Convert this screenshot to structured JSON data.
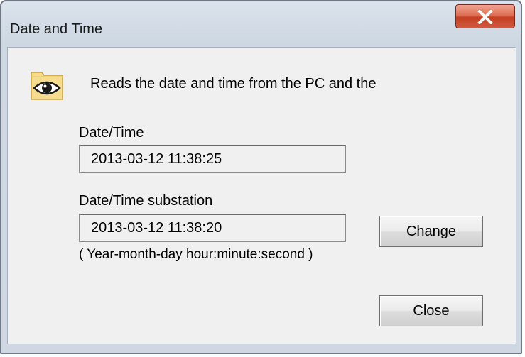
{
  "window": {
    "title": "Date and Time"
  },
  "icons": {
    "titlebar_close": "close-icon",
    "header": "eye-icon"
  },
  "description": "Reads the date and time from the PC and the",
  "pc_datetime": {
    "label": "Date/Time",
    "value": "2013-03-12  11:38:25"
  },
  "substation_datetime": {
    "label": "Date/Time substation",
    "value": "2013-03-12  11:38:20",
    "format_hint": "( Year-month-day hour:minute:second )"
  },
  "buttons": {
    "change": "Change",
    "close": "Close"
  },
  "colors": {
    "close_button_red": "#c43f22",
    "client_background": "#f0f0f0"
  }
}
